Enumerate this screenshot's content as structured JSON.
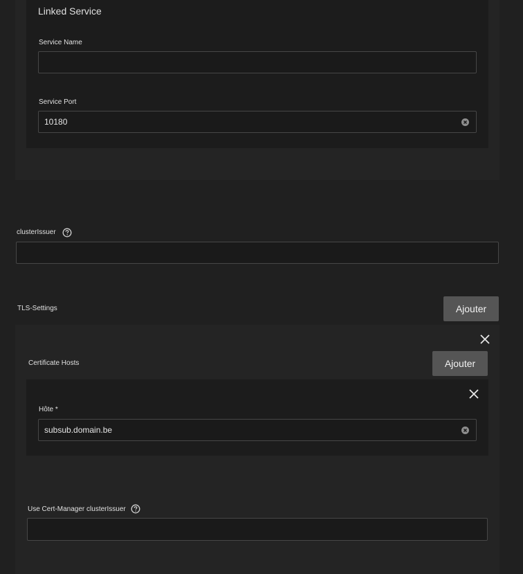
{
  "linked_service": {
    "title": "Linked Service",
    "service_name_label": "Service Name",
    "service_name_value": "",
    "service_port_label": "Service Port",
    "service_port_value": "10180"
  },
  "cluster_issuer": {
    "label": "clusterIssuer",
    "value": ""
  },
  "tls_settings": {
    "label": "TLS-Settings",
    "add_label": "Ajouter",
    "certificate_hosts": {
      "label": "Certificate Hosts",
      "add_label": "Ajouter",
      "host_label": "Hôte *",
      "host_value": "subsub.domain.be"
    },
    "cert_manager": {
      "label": "Use Cert-Manager clusterIssuer",
      "value": ""
    }
  },
  "icons": {
    "clear": "clear-icon",
    "help": "help-icon",
    "close": "close-icon"
  }
}
